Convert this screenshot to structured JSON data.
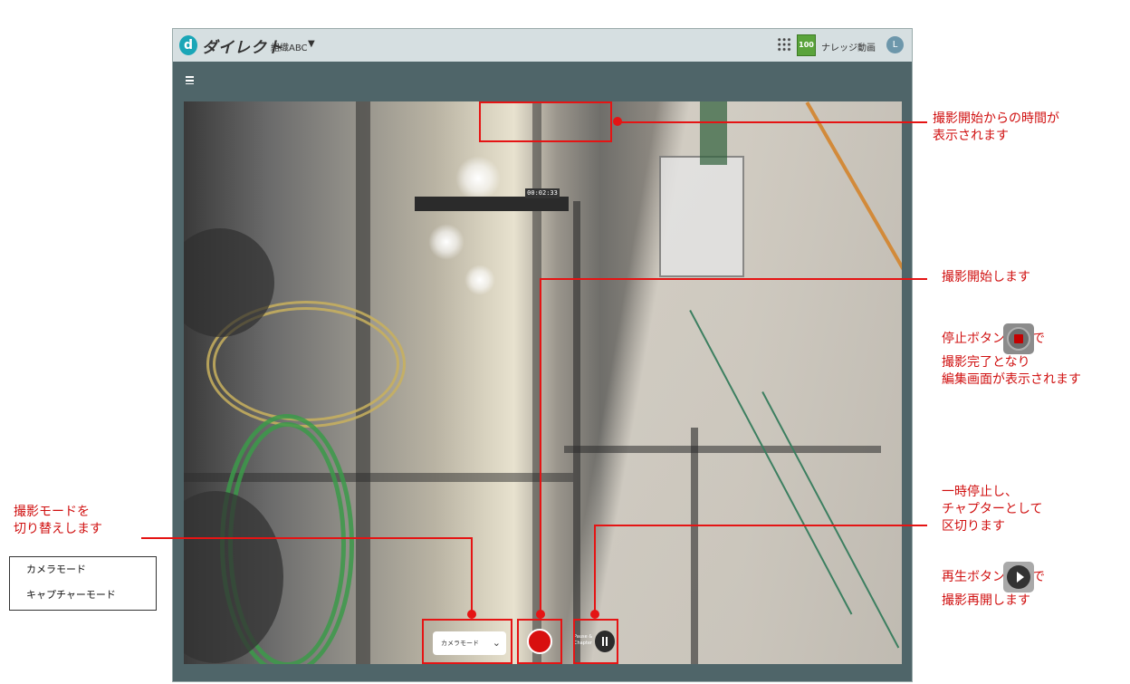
{
  "app": {
    "logo_mark": "d",
    "logo_text": "ダイレクト",
    "org_name": "組織ABC",
    "badge": "100",
    "knowledge_link": "ナレッジ動画",
    "avatar_initial": "L"
  },
  "recorder": {
    "elapsed_time": "00:02:33",
    "mode_selected": "カメラモード",
    "pause_label": "Pause & Chapter"
  },
  "mode_options": [
    "カメラモード",
    "キャプチャーモード"
  ],
  "annotations": {
    "elapsed": [
      "撮影開始からの時間が",
      "表示されます"
    ],
    "record": [
      "撮影開始します"
    ],
    "stop": [
      "停止ボタン",
      "で",
      "撮影完了となり",
      "編集画面が表示されます"
    ],
    "pause": [
      "一時停止し、",
      "チャプターとして",
      "区切ります"
    ],
    "resume": [
      "再生ボタン",
      "で",
      "撮影再開します"
    ],
    "mode": [
      "撮影モードを",
      "切り替えします"
    ]
  },
  "colors": {
    "annotation": "#e51414",
    "header_bg": "#d6dfe1",
    "frame_bg": "#4f6569",
    "record": "#d80f0f"
  }
}
